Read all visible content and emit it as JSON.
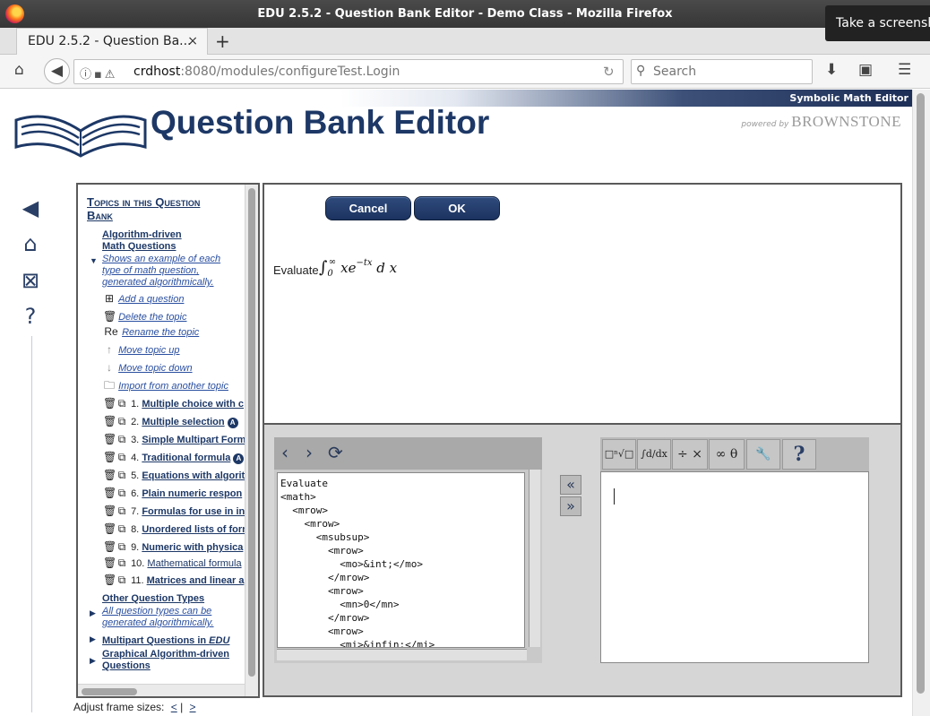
{
  "window": {
    "title": "EDU 2.5.2 - Question Bank Editor - Demo Class - Mozilla Firefox",
    "toast": "Take a screenshot"
  },
  "tab": {
    "label": "EDU 2.5.2 - Question Ba...",
    "close": "×",
    "new": "+"
  },
  "nav": {
    "url_host": "crdhost",
    "url_rest": ":8080/modules/configureTest.Login",
    "search_placeholder": "Search"
  },
  "banner": {
    "label": "Symbolic Math Editor"
  },
  "header": {
    "title": "Question Bank Editor",
    "powered_by": "powered by",
    "brand": "BROWNSTONE"
  },
  "topics": {
    "title_line1": "Topics in this Question",
    "title_line2": "Bank",
    "section1": {
      "title_line1": "Algorithm-driven",
      "title_line2": "Math Questions",
      "desc": [
        "Shows an example of each",
        "type of math question,",
        "generated algorithmically."
      ]
    },
    "actions": [
      {
        "icon": "⊞",
        "label": "Add a question"
      },
      {
        "icon": "🗑",
        "label": "Delete the topic"
      },
      {
        "icon": "Re",
        "label": "Rename the topic"
      },
      {
        "icon": "↑",
        "label": "Move topic up"
      },
      {
        "icon": "↓",
        "label": "Move topic down"
      },
      {
        "icon": "🗀",
        "label": "Import from another topic"
      }
    ],
    "questions": [
      {
        "num": "1.",
        "label": "Multiple choice with c",
        "badge": ""
      },
      {
        "num": "2.",
        "label": "Multiple selection",
        "badge": "A"
      },
      {
        "num": "3.",
        "label": "Simple Multipart Form",
        "badge": ""
      },
      {
        "num": "4.",
        "label": "Traditional formula",
        "badge": "A"
      },
      {
        "num": "5.",
        "label": "Equations with algorit",
        "badge": ""
      },
      {
        "num": "6.",
        "label": "Plain numeric respon",
        "badge": ""
      },
      {
        "num": "7.",
        "label": "Formulas for use in in",
        "badge": ""
      },
      {
        "num": "8.",
        "label": "Unordered lists of forn",
        "badge": ""
      },
      {
        "num": "9.",
        "label": "Numeric with physica",
        "badge": ""
      },
      {
        "num": "10.",
        "label": "Mathematical formula",
        "badge": ""
      },
      {
        "num": "11.",
        "label": "Matrices and linear a",
        "badge": ""
      }
    ],
    "section2": {
      "title": "Other Question Types",
      "desc": [
        "All question types can be",
        "generated algorithmically."
      ]
    },
    "section3": {
      "title_a": "Multipart Questions in ",
      "title_b": "EDU"
    },
    "section4": {
      "title_line1": "Graphical Algorithm-driven",
      "title_line2": "Questions"
    }
  },
  "editor": {
    "cancel": "Cancel",
    "ok": "OK",
    "evaluate": "Evaluate",
    "math_int": "∫",
    "math_sub": "0",
    "math_sup": "∞",
    "math_body": "xe",
    "math_exp": "−tx",
    "math_dx": "d x",
    "code": "Evaluate\n<math>\n  <mrow>\n    <mrow>\n      <msubsup>\n        <mrow>\n          <mo>&int;</mo>\n        </mrow>\n        <mrow>\n          <mn>0</mn>\n        </mrow>\n        <mrow>\n          <mi>&infin;</mi>",
    "palette": [
      "□ⁿ√□",
      "∫d/dx",
      "÷ ×",
      "∞ θ",
      "🔧",
      "?"
    ]
  },
  "footer": {
    "label": "Adjust frame sizes:",
    "less": "<",
    "sep": "|",
    "more": ">"
  }
}
